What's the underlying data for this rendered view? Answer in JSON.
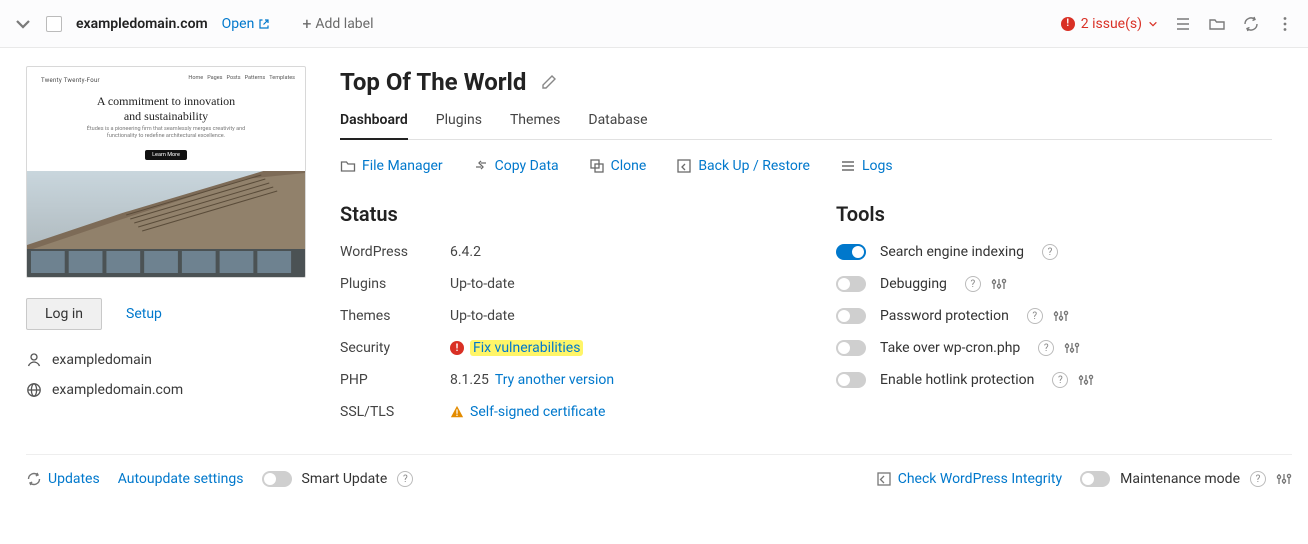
{
  "topbar": {
    "domain": "exampledomain.com",
    "open_label": "Open",
    "add_label_text": "Add label",
    "issues_text": "2 issue(s)"
  },
  "sidebar": {
    "login_label": "Log in",
    "setup_label": "Setup",
    "user_label": "exampledomain",
    "site_label": "exampledomain.com",
    "preview": {
      "brand": "Twenty Twenty-Four",
      "nav": [
        "Home",
        "Pages",
        "Posts",
        "Patterns",
        "Templates"
      ],
      "headline_a": "A commitment to innovation",
      "headline_b": "and sustainability",
      "blurb": "Études is a pioneering firm that seamlessly merges creativity and functionality to redefine architectural excellence.",
      "cta": "Learn More"
    }
  },
  "page": {
    "title": "Top Of The World",
    "tabs": [
      "Dashboard",
      "Plugins",
      "Themes",
      "Database"
    ],
    "active_tab": 0
  },
  "actions": {
    "file_manager": "File Manager",
    "copy_data": "Copy Data",
    "clone": "Clone",
    "backup": "Back Up / Restore",
    "logs": "Logs"
  },
  "status": {
    "heading": "Status",
    "rows": {
      "wordpress": {
        "label": "WordPress",
        "value": "6.4.2"
      },
      "plugins": {
        "label": "Plugins",
        "value": "Up-to-date"
      },
      "themes": {
        "label": "Themes",
        "value": "Up-to-date"
      },
      "security": {
        "label": "Security",
        "link": "Fix vulnerabilities"
      },
      "php": {
        "label": "PHP",
        "value": "8.1.25",
        "link": "Try another version"
      },
      "ssl": {
        "label": "SSL/TLS",
        "link": "Self-signed certificate"
      }
    }
  },
  "tools": {
    "heading": "Tools",
    "items": {
      "sei": {
        "label": "Search engine indexing",
        "on": true,
        "gear": false
      },
      "debug": {
        "label": "Debugging",
        "on": false,
        "gear": true
      },
      "pwd": {
        "label": "Password protection",
        "on": false,
        "gear": true
      },
      "cron": {
        "label": "Take over wp-cron.php",
        "on": false,
        "gear": true
      },
      "hot": {
        "label": "Enable hotlink protection",
        "on": false,
        "gear": true
      }
    }
  },
  "footer": {
    "updates": "Updates",
    "autoupdate": "Autoupdate settings",
    "smart_update": "Smart Update",
    "integrity": "Check WordPress Integrity",
    "maintenance": "Maintenance mode"
  }
}
